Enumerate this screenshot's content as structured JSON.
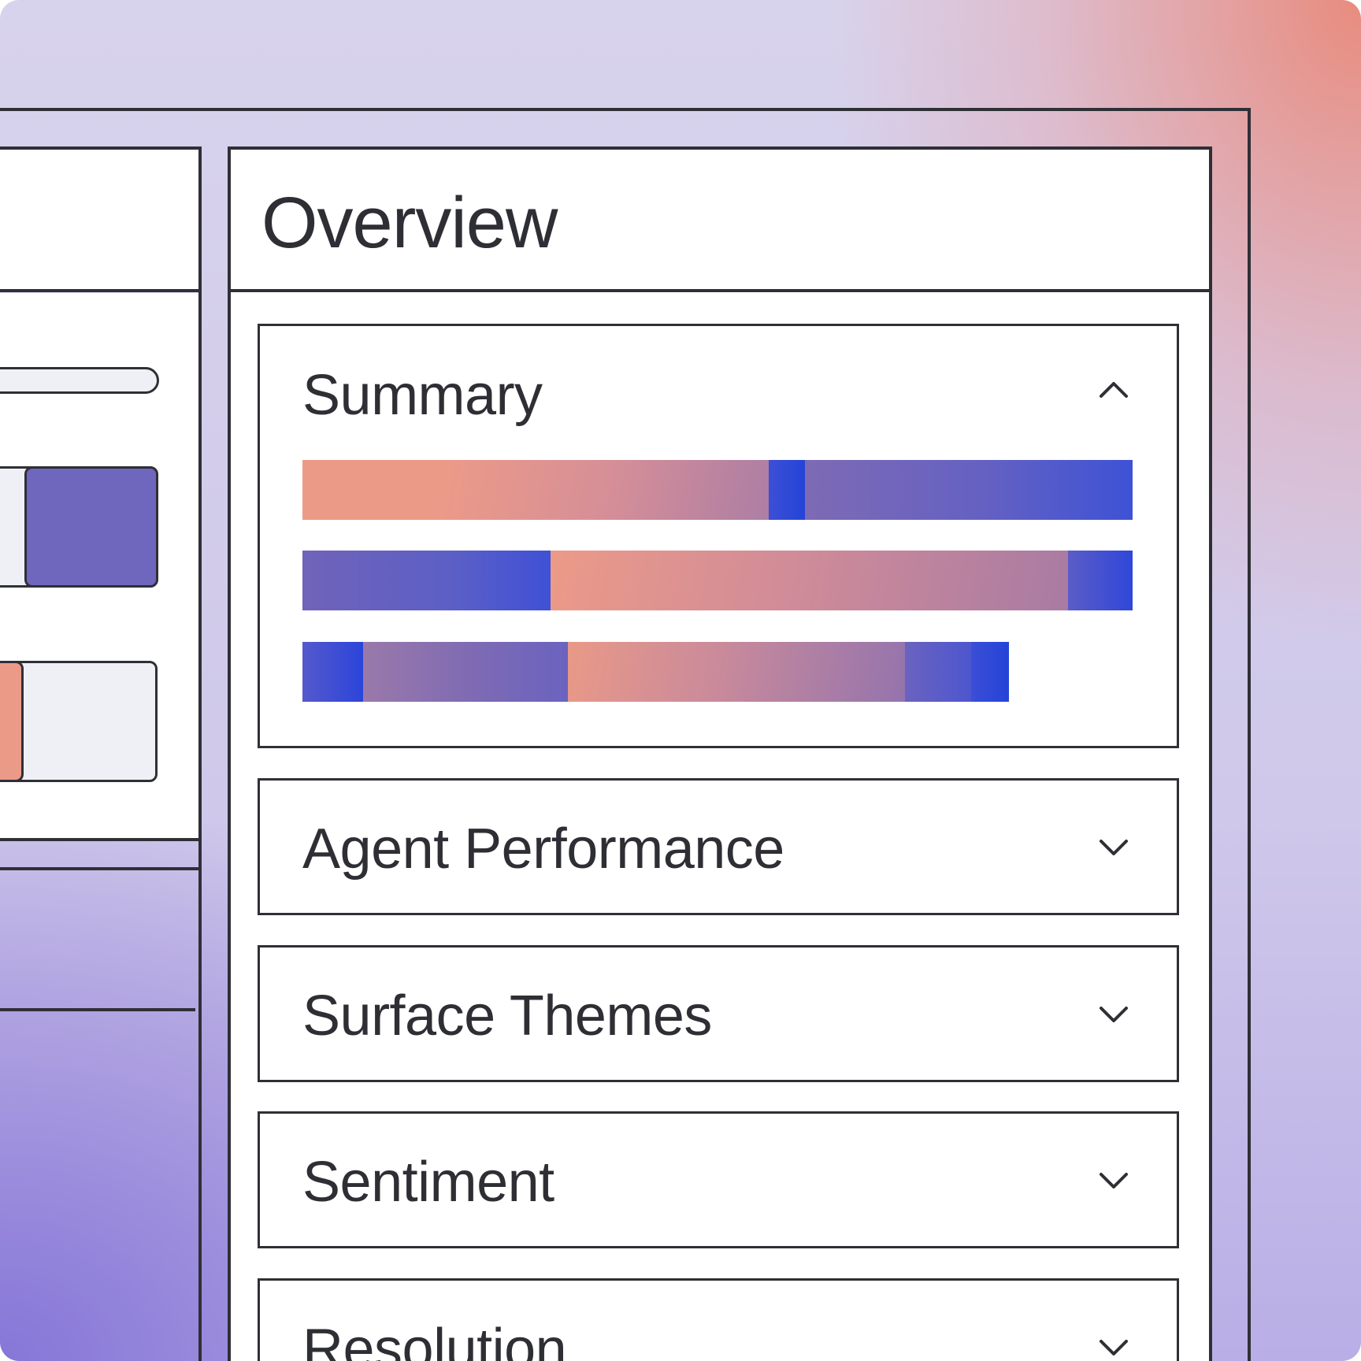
{
  "overview": {
    "title": "Overview"
  },
  "accordion": [
    {
      "label": "Summary",
      "expanded": true,
      "icon": "chevron-up-icon"
    },
    {
      "label": "Agent Performance",
      "expanded": false,
      "icon": "chevron-down-icon"
    },
    {
      "label": "Surface Themes",
      "expanded": false,
      "icon": "chevron-down-icon"
    },
    {
      "label": "Sentiment",
      "expanded": false,
      "icon": "chevron-down-icon"
    },
    {
      "label": "Resolution",
      "expanded": false,
      "icon": "chevron-down-icon"
    }
  ],
  "colors": {
    "salmon": "#ec9a88",
    "mauve": "#a77ba0",
    "violet": "#7566b8",
    "blue": "#2a44db",
    "chip_purple": "#6f66bd",
    "outline": "#2f2f36"
  }
}
